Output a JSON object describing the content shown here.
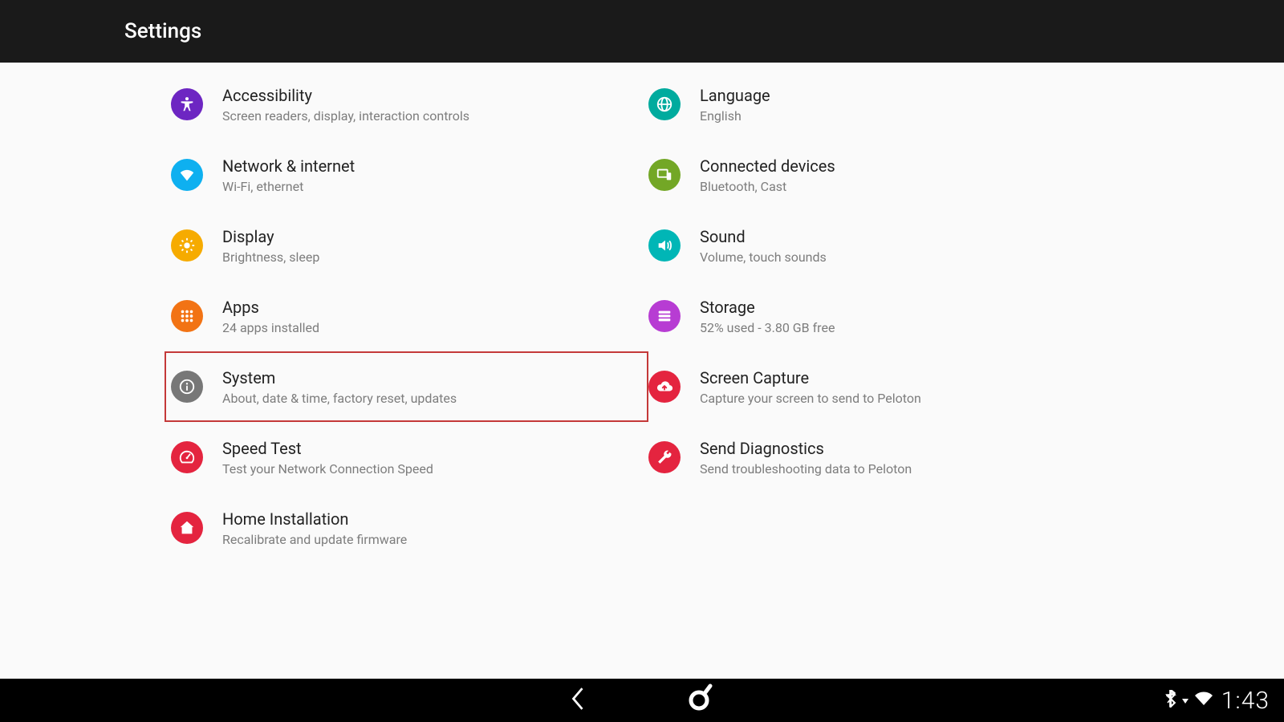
{
  "header": {
    "title": "Settings"
  },
  "left": [
    {
      "icon": "accessibility-icon",
      "color": "bg-purple",
      "title": "Accessibility",
      "sub": "Screen readers, display, interaction controls"
    },
    {
      "icon": "wifi-icon",
      "color": "bg-blue",
      "title": "Network & internet",
      "sub": "Wi-Fi, ethernet"
    },
    {
      "icon": "brightness-icon",
      "color": "bg-amber",
      "title": "Display",
      "sub": "Brightness, sleep"
    },
    {
      "icon": "apps-grid-icon",
      "color": "bg-orange",
      "title": "Apps",
      "sub": "24 apps installed"
    },
    {
      "icon": "info-icon",
      "color": "bg-gray",
      "title": "System",
      "sub": "About, date & time, factory reset, updates",
      "highlighted": true
    },
    {
      "icon": "speed-icon",
      "color": "bg-red",
      "title": "Speed Test",
      "sub": "Test your Network Connection Speed"
    },
    {
      "icon": "home-icon",
      "color": "bg-red",
      "title": "Home Installation",
      "sub": "Recalibrate and update firmware"
    }
  ],
  "right": [
    {
      "icon": "globe-icon",
      "color": "bg-teal",
      "title": "Language",
      "sub": "English"
    },
    {
      "icon": "devices-icon",
      "color": "bg-olive",
      "title": "Connected devices",
      "sub": "Bluetooth, Cast"
    },
    {
      "icon": "volume-icon",
      "color": "bg-teal2",
      "title": "Sound",
      "sub": "Volume, touch sounds"
    },
    {
      "icon": "storage-icon",
      "color": "bg-violet",
      "title": "Storage",
      "sub": "52% used - 3.80 GB free"
    },
    {
      "icon": "cloud-upload-icon",
      "color": "bg-red",
      "title": "Screen Capture",
      "sub": "Capture your screen to send to Peloton"
    },
    {
      "icon": "wrench-icon",
      "color": "bg-red",
      "title": "Send Diagnostics",
      "sub": "Send troubleshooting data to Peloton"
    }
  ],
  "statusbar": {
    "time": "1:43"
  }
}
